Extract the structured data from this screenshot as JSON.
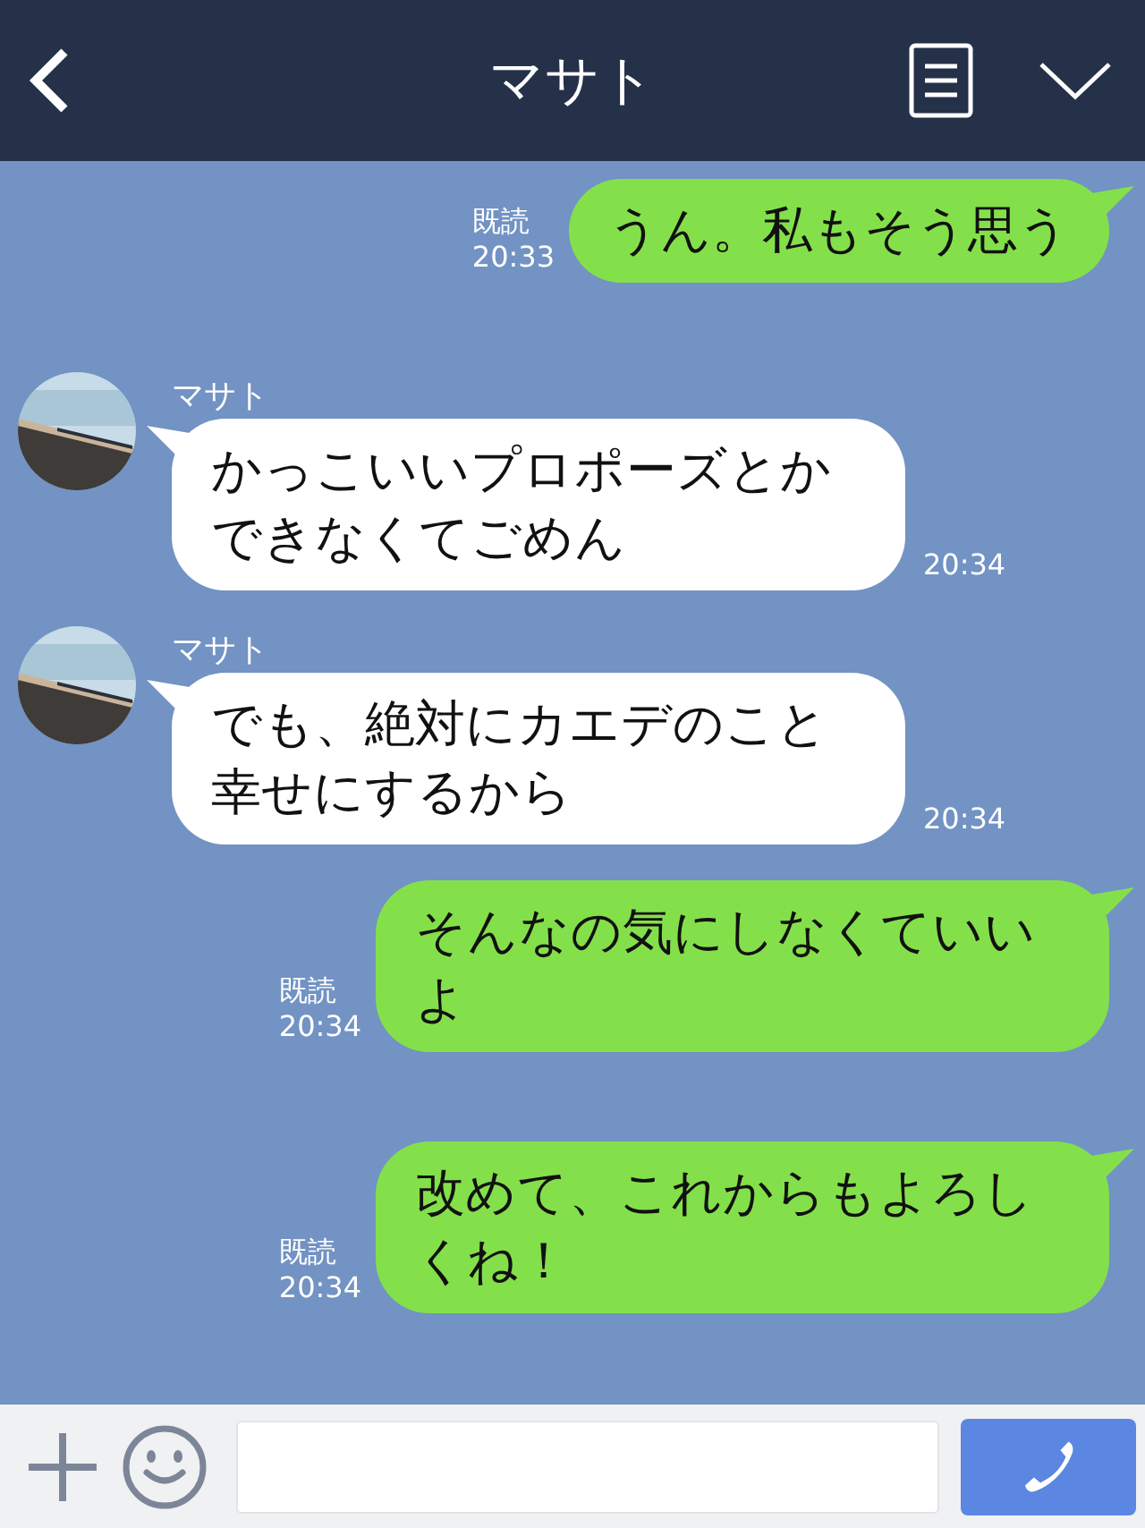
{
  "header": {
    "title": "マサト"
  },
  "messages": [
    {
      "kind": "sent",
      "text": "うん。私もそう思う",
      "read": "既読",
      "time": "20:33"
    },
    {
      "kind": "received",
      "sender": "マサト",
      "text": "かっこいいプロポーズとかできなくてごめん",
      "time": "20:34"
    },
    {
      "kind": "received",
      "sender": "マサト",
      "text": "でも、絶対にカエデのこと幸せにするから",
      "time": "20:34"
    },
    {
      "kind": "sent",
      "text": "そんなの気にしなくていいよ",
      "read": "既読",
      "time": "20:34"
    },
    {
      "kind": "sent",
      "text": "改めて、これからもよろしくね！",
      "read": "既読",
      "time": "20:34"
    }
  ]
}
